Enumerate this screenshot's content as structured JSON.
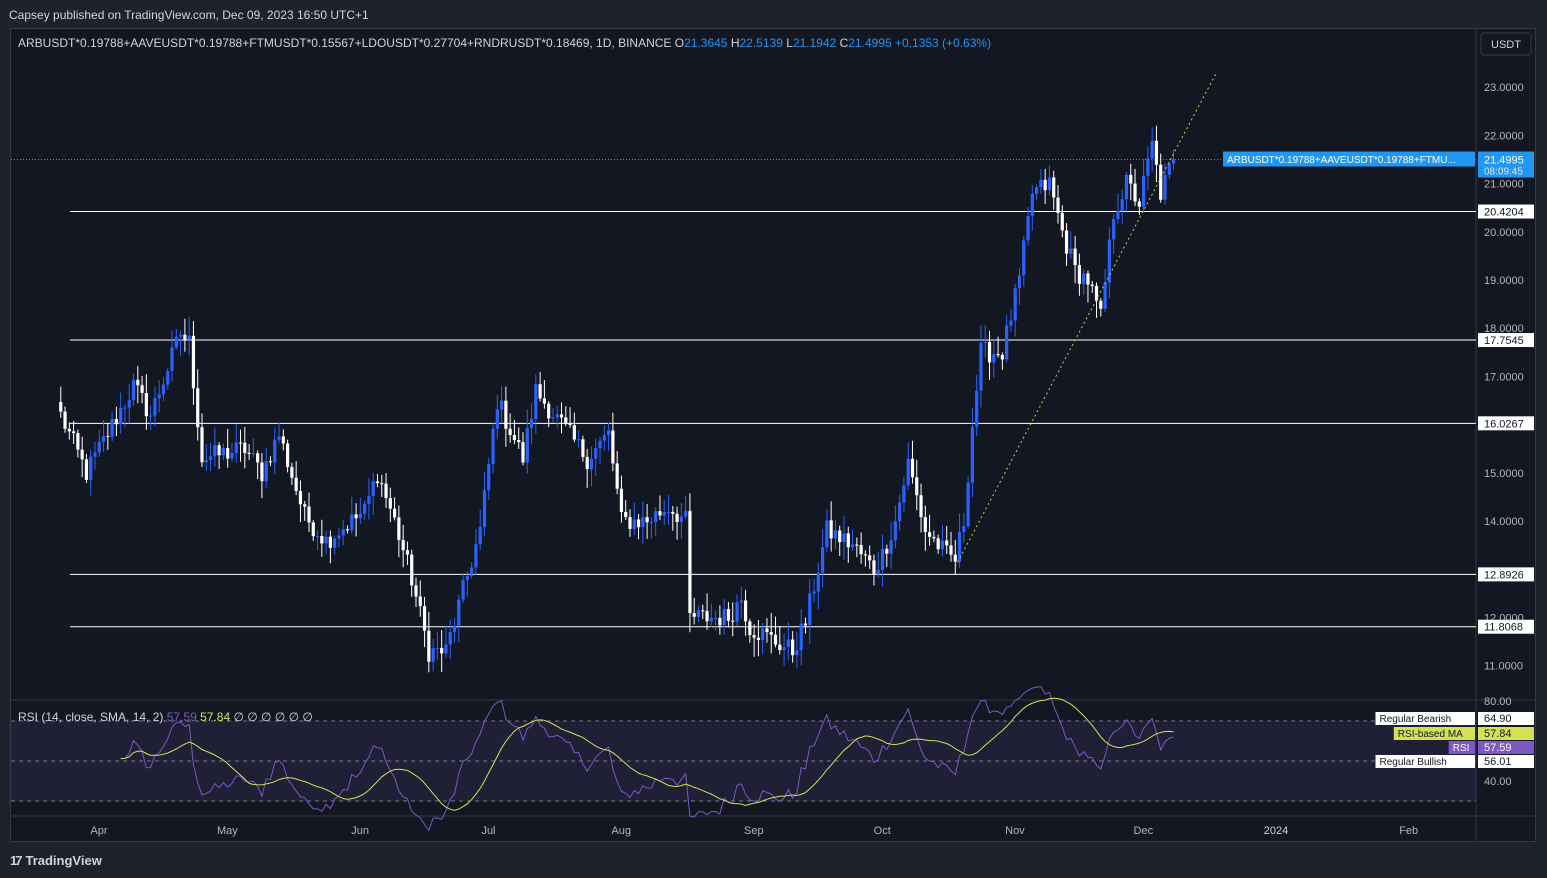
{
  "header": {
    "published": "Capsey published on TradingView.com, Dec 09, 2023 16:50 UTC+1"
  },
  "legend": {
    "symbol": "ARBUSDT*0.19788+AAVEUSDT*0.19788+FTMUSDT*0.15567+LDOUSDT*0.27704+RNDRUSDT*0.18469, 1D, BINANCE",
    "o_label": "O",
    "o_value": "21.3645",
    "h_label": "H",
    "h_value": "22.5139",
    "l_label": "L",
    "l_value": "21.1942",
    "c_label": "C",
    "c_value": "21.4995",
    "change": "+0.1353 (+0.63%)"
  },
  "currency_button": "USDT",
  "last_price_tag": {
    "label": "ARBUSDT*0.19788+AAVEUSDT*0.19788+FTMU...",
    "price": "21.4995",
    "countdown": "08:09:45"
  },
  "colors": {
    "background": "#131722",
    "up_candle": "#2962ff",
    "down_candle": "#ffffff",
    "accent": "#2196f3",
    "rsi_line": "#7e57c2",
    "rsi_ma": "#d4e157",
    "trendline": "#c9c95a"
  },
  "chart_data": {
    "type": "candlestick",
    "title": "",
    "ylim": [
      10.2,
      23.3
    ],
    "y_ticks": [
      "23.0000",
      "22.0000",
      "21.0000",
      "20.0000",
      "19.0000",
      "18.0000",
      "17.0000",
      "15.0000",
      "14.0000",
      "12.0000",
      "11.0000"
    ],
    "x_ticks": [
      "Apr",
      "May",
      "Jun",
      "Jul",
      "Aug",
      "Sep",
      "Oct",
      "Nov",
      "Dec",
      "2024",
      "Feb"
    ],
    "horizontal_levels": [
      20.4204,
      17.7545,
      16.0267,
      12.8926,
      11.8068
    ],
    "level_labels": [
      "20.4204",
      "17.7545",
      "16.0267",
      "12.8926",
      "11.8068"
    ],
    "trendline": {
      "from": [
        "Oct 19",
        13.05
      ],
      "to": [
        "Dec 19",
        23.3
      ]
    },
    "anchors": [
      {
        "d": "Mar 24",
        "v": 16.2
      },
      {
        "d": "Mar 30",
        "v": 15.0
      },
      {
        "d": "Apr 10",
        "v": 16.8
      },
      {
        "d": "Apr 14",
        "v": 16.2
      },
      {
        "d": "Apr 21",
        "v": 17.9
      },
      {
        "d": "Apr 23",
        "v": 17.7
      },
      {
        "d": "Apr 26",
        "v": 15.3
      },
      {
        "d": "May 6",
        "v": 15.5
      },
      {
        "d": "May 10",
        "v": 15.0
      },
      {
        "d": "May 14",
        "v": 15.8
      },
      {
        "d": "May 20",
        "v": 14.1
      },
      {
        "d": "May 25",
        "v": 13.6
      },
      {
        "d": "Jun 3",
        "v": 14.2
      },
      {
        "d": "Jun 6",
        "v": 15.0
      },
      {
        "d": "Jun 10",
        "v": 14.0
      },
      {
        "d": "Jun 14",
        "v": 12.8
      },
      {
        "d": "Jun 18",
        "v": 11.3
      },
      {
        "d": "Jun 22",
        "v": 11.3
      },
      {
        "d": "Jun 30",
        "v": 13.8
      },
      {
        "d": "Jul 4",
        "v": 16.5
      },
      {
        "d": "Jul 10",
        "v": 15.3
      },
      {
        "d": "Jul 13",
        "v": 16.7
      },
      {
        "d": "Jul 19",
        "v": 16.0
      },
      {
        "d": "Jul 25",
        "v": 15.3
      },
      {
        "d": "Jul 30",
        "v": 15.8
      },
      {
        "d": "Aug 2",
        "v": 14.0
      },
      {
        "d": "Aug 8",
        "v": 14.0
      },
      {
        "d": "Aug 13",
        "v": 14.3
      },
      {
        "d": "Aug 17",
        "v": 14.0
      },
      {
        "d": "Aug 18",
        "v": 12.0
      },
      {
        "d": "Aug 27",
        "v": 12.0
      },
      {
        "d": "Aug 30",
        "v": 12.4
      },
      {
        "d": "Sep 1",
        "v": 11.8
      },
      {
        "d": "Sep 11",
        "v": 11.3
      },
      {
        "d": "Sep 14",
        "v": 11.9
      },
      {
        "d": "Sep 19",
        "v": 13.8
      },
      {
        "d": "Sep 25",
        "v": 13.5
      },
      {
        "d": "Sep 30",
        "v": 13.0
      },
      {
        "d": "Oct 2",
        "v": 13.3
      },
      {
        "d": "Oct 5",
        "v": 14.0
      },
      {
        "d": "Oct 8",
        "v": 15.2
      },
      {
        "d": "Oct 12",
        "v": 13.8
      },
      {
        "d": "Oct 17",
        "v": 13.3
      },
      {
        "d": "Oct 19",
        "v": 13.2
      },
      {
        "d": "Oct 21",
        "v": 14.0
      },
      {
        "d": "Oct 23",
        "v": 16.0
      },
      {
        "d": "Oct 25",
        "v": 17.5
      },
      {
        "d": "Oct 30",
        "v": 17.5
      },
      {
        "d": "Nov 3",
        "v": 19.0
      },
      {
        "d": "Nov 6",
        "v": 20.8
      },
      {
        "d": "Nov 10",
        "v": 21.0
      },
      {
        "d": "Nov 13",
        "v": 20.0
      },
      {
        "d": "Nov 16",
        "v": 19.2
      },
      {
        "d": "Nov 19",
        "v": 19.0
      },
      {
        "d": "Nov 22",
        "v": 18.2
      },
      {
        "d": "Nov 25",
        "v": 20.4
      },
      {
        "d": "Nov 28",
        "v": 21.0
      },
      {
        "d": "Dec 1",
        "v": 20.6
      },
      {
        "d": "Dec 4",
        "v": 21.8
      },
      {
        "d": "Dec 6",
        "v": 20.8
      },
      {
        "d": "Dec 9",
        "v": 21.4995
      }
    ]
  },
  "rsi": {
    "legend_name": "RSI (14, close, SMA, 14, 2)",
    "value": "57.59",
    "ma_value": "57.84",
    "empty_marks": "∅ ∅ ∅ ∅ ∅ ∅",
    "ylim": [
      31,
      82
    ],
    "y_ticks": [
      "80.00",
      "40.00"
    ],
    "band_upper": 70,
    "band_middle": 50,
    "band_lower": 30,
    "tags": [
      {
        "label": "Regular Bearish",
        "value": "64.90"
      },
      {
        "label": "RSI-based MA",
        "value": "57.84"
      },
      {
        "label": "RSI",
        "value": "57.59"
      },
      {
        "label": "Regular Bullish",
        "value": "56.01"
      }
    ]
  },
  "footer": {
    "brand": "TradingView",
    "logo_glyph": "17"
  }
}
